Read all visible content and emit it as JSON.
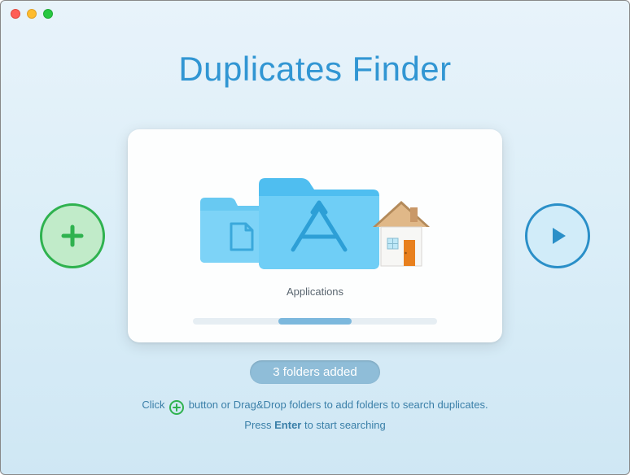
{
  "app_title": "Duplicates Finder",
  "card": {
    "selected_label": "Applications",
    "folders": [
      {
        "name": "Documents",
        "type": "documents-folder"
      },
      {
        "name": "Applications",
        "type": "applications-folder"
      },
      {
        "name": "Home",
        "type": "home-folder"
      }
    ]
  },
  "status": "3 folders added",
  "hints": {
    "line1_pre": "Click ",
    "line1_post": " button or Drag&Drop folders to add folders to search duplicates.",
    "line2_pre": "Press ",
    "line2_key": "Enter",
    "line2_post": " to start searching"
  },
  "colors": {
    "accent": "#3196d3",
    "add_green": "#2fb24f",
    "play_blue": "#2a8fc8"
  }
}
